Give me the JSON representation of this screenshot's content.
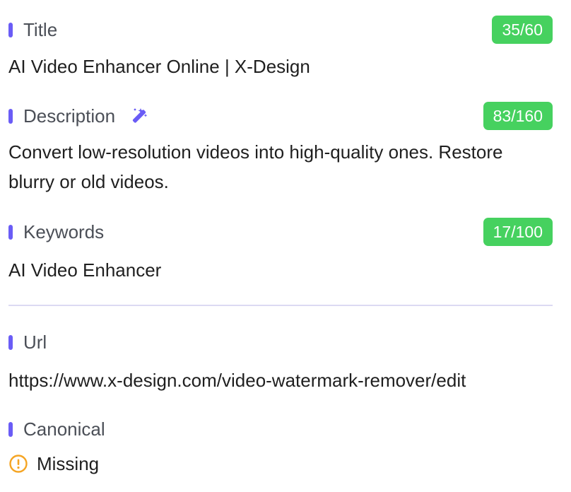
{
  "title": {
    "label": "Title",
    "count": "35/60",
    "value": "AI Video Enhancer Online | X-Design"
  },
  "description": {
    "label": "Description",
    "count": "83/160",
    "value": "Convert low-resolution videos into high-quality ones. Restore blurry or old videos.",
    "icon": "magic-wand-icon"
  },
  "keywords": {
    "label": "Keywords",
    "count": "17/100",
    "value": "AI Video Enhancer"
  },
  "url": {
    "label": "Url",
    "value": "https://www.x-design.com/video-watermark-remover/edit"
  },
  "canonical": {
    "label": "Canonical",
    "status": "Missing",
    "icon": "warning-circle-icon"
  },
  "colors": {
    "accent": "#6a5cf6",
    "badge": "#46d15f",
    "warning": "#f5a524",
    "divider": "#dcdaf3"
  }
}
